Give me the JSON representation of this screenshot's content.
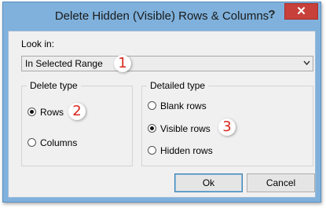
{
  "window": {
    "title": "Delete Hidden (Visible) Rows & Columns",
    "help_label": "?",
    "close_label": "✕"
  },
  "look_in": {
    "label": "Look in:",
    "selected_value": "In Selected Range",
    "badge": "1"
  },
  "delete_type": {
    "title": "Delete type",
    "options": [
      {
        "label": "Rows",
        "checked": true
      },
      {
        "label": "Columns",
        "checked": false
      }
    ],
    "badge": "2"
  },
  "detailed_type": {
    "title": "Detailed type",
    "options": [
      {
        "label": "Blank rows",
        "checked": false
      },
      {
        "label": "Visible rows",
        "checked": true
      },
      {
        "label": "Hidden rows",
        "checked": false
      }
    ],
    "badge": "3"
  },
  "buttons": {
    "ok": "Ok",
    "cancel": "Cancel"
  },
  "colors": {
    "title_bar": "#7fb1dc",
    "close_button": "#c7403a",
    "badge_number": "#d9261c"
  },
  "icons": {
    "combo": "chevron-down-icon",
    "close": "close-icon",
    "help": "help-icon"
  }
}
